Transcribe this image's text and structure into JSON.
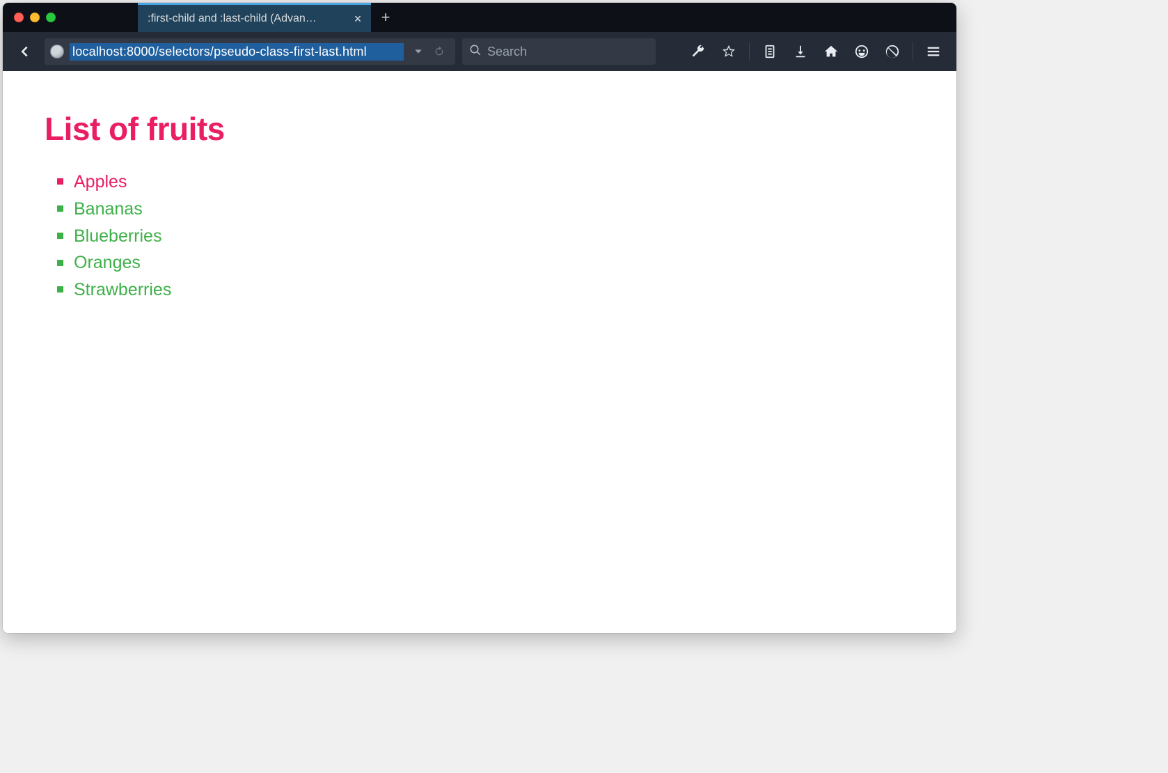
{
  "window": {
    "tab_title": ":first-child and :last-child (Advan…",
    "url": "localhost:8000/selectors/pseudo-class-first-last.html",
    "search_placeholder": "Search"
  },
  "page": {
    "heading": "List of fruits",
    "items": [
      "Apples",
      "Bananas",
      "Blueberries",
      "Oranges",
      "Strawberries"
    ]
  },
  "colors": {
    "accent_pink": "#e91e63",
    "accent_green": "#3eb049",
    "tab_active_bg": "#20425a",
    "tab_highlight": "#4aa6e0",
    "chrome_bg_dark": "#0d1117",
    "chrome_bg": "#252c38",
    "input_bg": "#333a45",
    "url_selection": "#205f9e"
  },
  "icons": {
    "back": "arrow-left-icon",
    "dropdown": "chevron-down-icon",
    "reload": "reload-icon",
    "search": "search-icon",
    "devtools": "wrench-icon",
    "bookmark": "star-icon",
    "reading_list": "clipboard-icon",
    "downloads": "download-icon",
    "home": "home-icon",
    "pocket": "smiley-icon",
    "noscript": "noscript-icon",
    "menu": "hamburger-icon",
    "close_tab": "close-icon",
    "new_tab": "plus-icon",
    "globe": "globe-icon"
  }
}
